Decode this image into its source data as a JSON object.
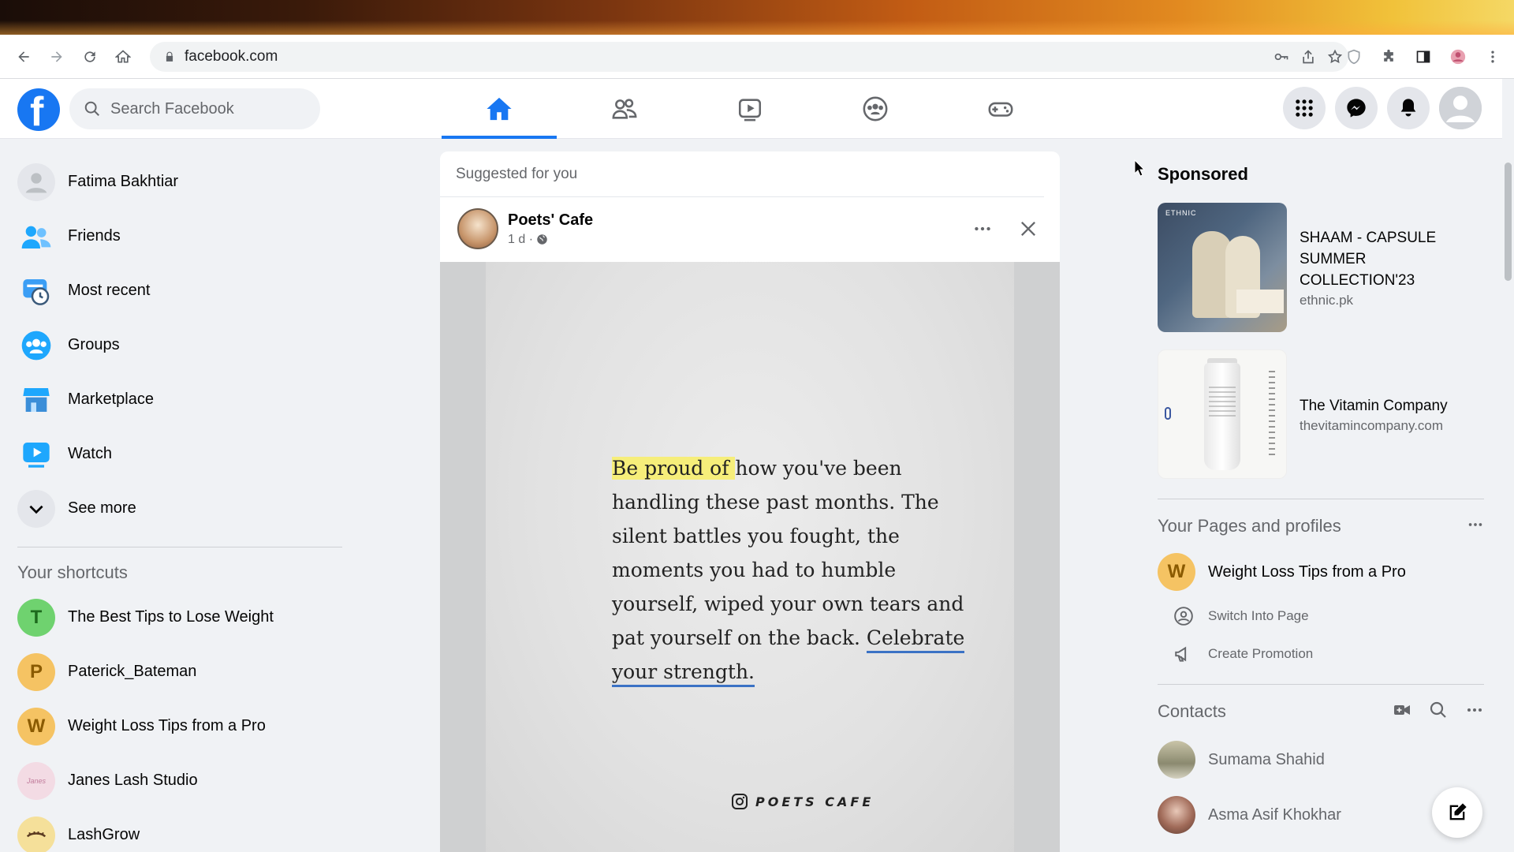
{
  "browser": {
    "url": "facebook.com"
  },
  "header": {
    "logo": "f",
    "search_placeholder": "Search Facebook",
    "tabs": [
      {
        "name": "home-icon"
      },
      {
        "name": "friends-icon"
      },
      {
        "name": "watch-icon"
      },
      {
        "name": "groups-icon"
      },
      {
        "name": "gaming-icon"
      }
    ]
  },
  "left_sidebar": {
    "items": [
      {
        "label": "Fatima Bakhtiar"
      },
      {
        "label": "Friends"
      },
      {
        "label": "Most recent"
      },
      {
        "label": "Groups"
      },
      {
        "label": "Marketplace"
      },
      {
        "label": "Watch"
      },
      {
        "label": "See more"
      }
    ],
    "shortcuts_heading": "Your shortcuts",
    "shortcuts": [
      {
        "label": "The Best Tips to Lose Weight",
        "letter": "T",
        "color": "#6fd26f"
      },
      {
        "label": "Paterick_Bateman",
        "letter": "P",
        "color": "#f5c363"
      },
      {
        "label": "Weight Loss Tips from a Pro",
        "letter": "W",
        "color": "#f5c363"
      },
      {
        "label": "Janes Lash Studio",
        "letter": "Janes",
        "color": "#f3dbe4"
      },
      {
        "label": "LashGrow",
        "letter": "",
        "color": "#f5e09a"
      }
    ]
  },
  "feed": {
    "suggested_label": "Suggested for you",
    "post": {
      "author": "Poets' Cafe",
      "time": "1 d ·",
      "quote_highlight": "Be proud of ",
      "quote_rest_1": "how you've been handling these past months. The silent battles you fought, the moments you had to humble yourself, wiped your own tears and pat yourself on the back. ",
      "quote_underlined": "Celebrate your strength.",
      "watermark": "POETS CAFE"
    }
  },
  "right_sidebar": {
    "sponsored_heading": "Sponsored",
    "ads": [
      {
        "title": "SHAAM - CAPSULE SUMMER COLLECTION'23",
        "domain": "ethnic.pk",
        "tag": "ETHNIC"
      },
      {
        "title": "The Vitamin Company",
        "domain": "thevitamincompany.com"
      }
    ],
    "pages_heading": "Your Pages and profiles",
    "page": {
      "name": "Weight Loss Tips from a Pro",
      "letter": "W"
    },
    "page_actions": [
      {
        "label": "Switch Into Page"
      },
      {
        "label": "Create Promotion"
      }
    ],
    "contacts_heading": "Contacts",
    "contacts": [
      {
        "name": "Sumama Shahid"
      },
      {
        "name": "Asma Asif Khokhar"
      }
    ]
  },
  "colors": {
    "brand": "#1877f2",
    "highlight": "#f6ee7a"
  }
}
